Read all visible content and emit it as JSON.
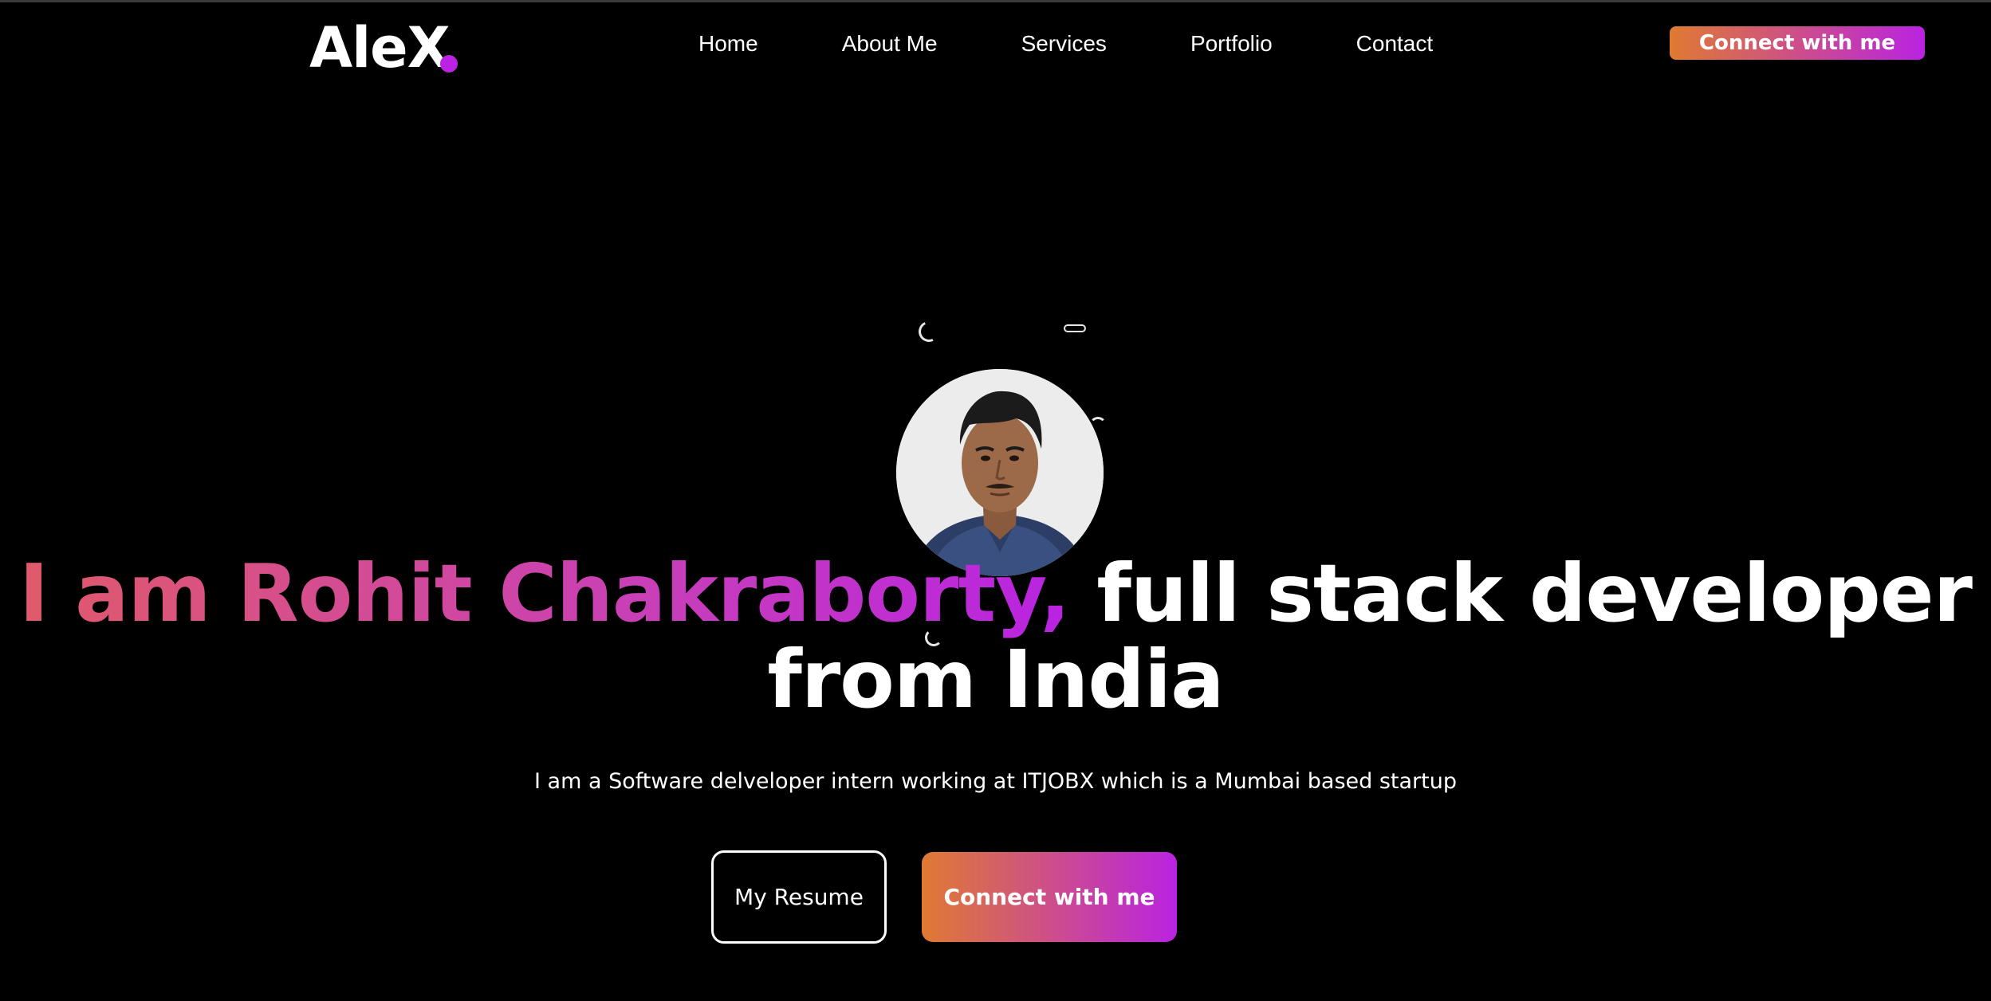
{
  "colors": {
    "background": "#000000",
    "text": "#ffffff",
    "gradient_start": "#e07a32",
    "gradient_end": "#b923e1",
    "accent_dot": "#b923e1"
  },
  "header": {
    "logo": "AleX",
    "nav": [
      {
        "label": "Home"
      },
      {
        "label": "About Me"
      },
      {
        "label": "Services"
      },
      {
        "label": "Portfolio"
      },
      {
        "label": "Contact"
      }
    ],
    "cta_label": "Connect with me"
  },
  "hero": {
    "avatar_icon": "profile-photo",
    "headline_accent": "I am Rohit Chakraborty,",
    "headline_rest": " full stack developer from India",
    "subtitle": "I am a Software delveloper intern working at ITJOBX which is a Mumbai based startup",
    "resume_label": "My Resume",
    "connect_label": "Connect with me"
  }
}
